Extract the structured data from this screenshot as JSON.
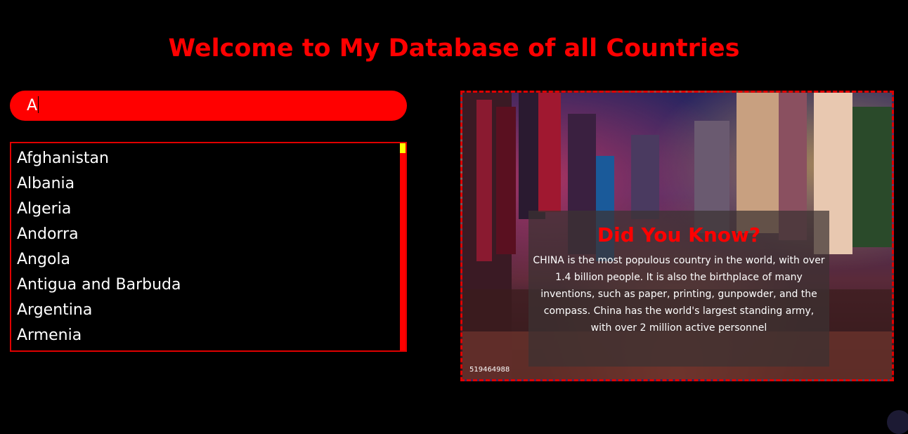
{
  "page": {
    "title": "Welcome to My Database of all Countries"
  },
  "search": {
    "value": "A"
  },
  "countries": [
    "Afghanistan",
    "Albania",
    "Algeria",
    "Andorra",
    "Angola",
    "Antigua and Barbuda",
    "Argentina",
    "Armenia"
  ],
  "fact": {
    "heading": "Did You Know?",
    "text": "CHINA is the most populous country in the world, with over 1.4 billion people. It is also the birthplace of many inventions, such as paper, printing, gunpowder, and the compass. China has the world's largest standing army, with over 2 million active personnel",
    "image_credit": "519464988"
  },
  "colors": {
    "accent": "#ff0000",
    "background": "#000000",
    "thumb": "#ffff00"
  }
}
